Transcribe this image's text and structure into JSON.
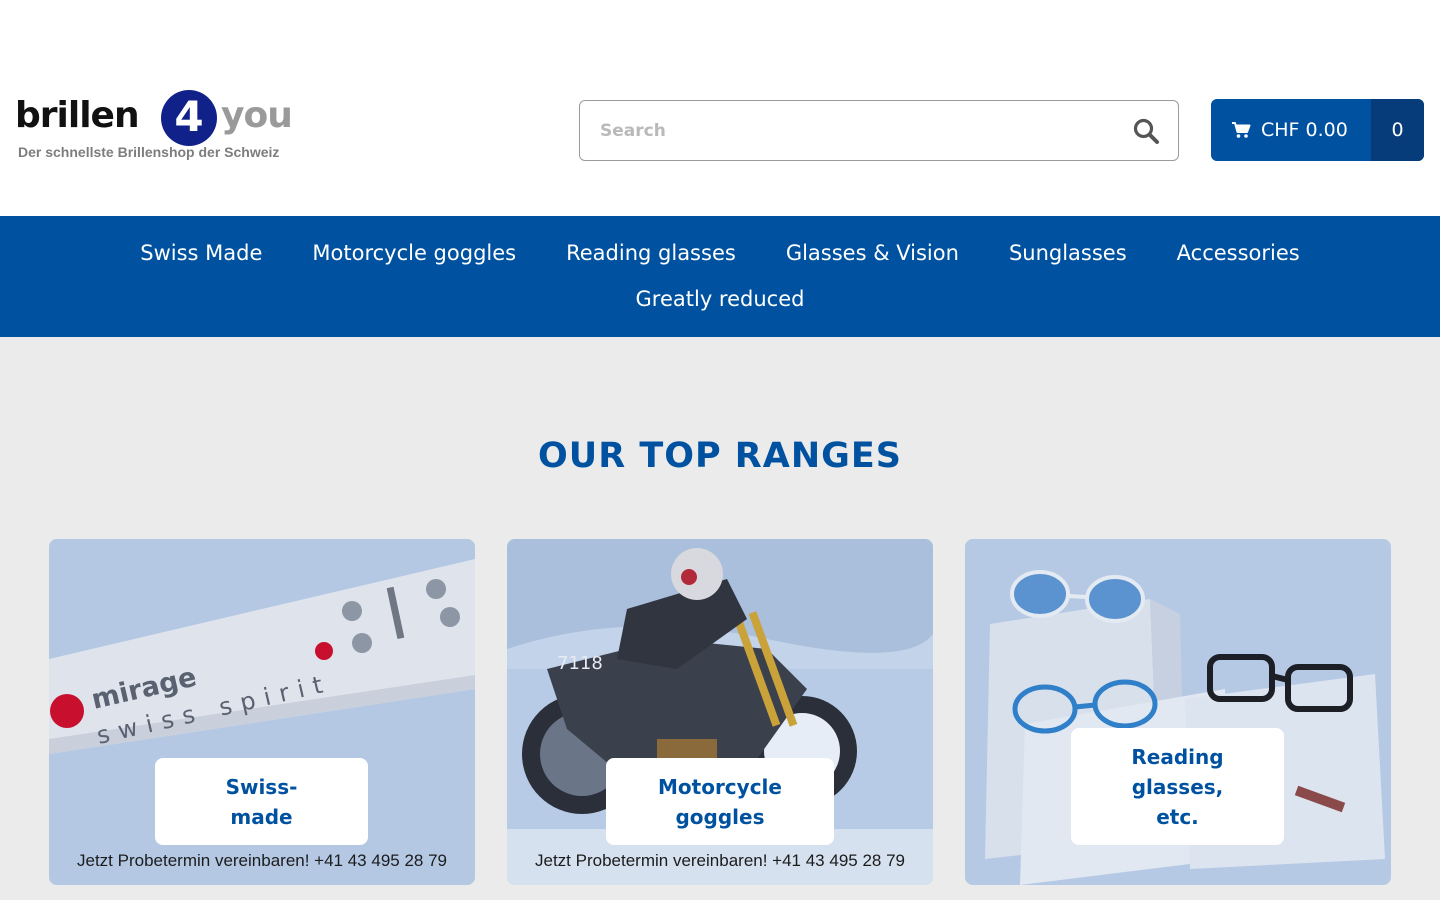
{
  "brand": {
    "name_part1": "brillen",
    "name_digit": "4",
    "name_part2": "you",
    "tagline": "Der schnellste Brillenshop der Schweiz"
  },
  "search": {
    "placeholder": "Search",
    "icon": "magnifier-icon"
  },
  "cart": {
    "icon": "shopping-cart-icon",
    "total": "CHF 0.00",
    "count": "0"
  },
  "nav": {
    "items": [
      {
        "label": "Swiss Made"
      },
      {
        "label": "Motorcycle goggles"
      },
      {
        "label": "Reading glasses"
      },
      {
        "label": "Glasses & Vision"
      },
      {
        "label": "Sunglasses"
      },
      {
        "label": "Accessories"
      },
      {
        "label": "Greatly reduced"
      }
    ]
  },
  "ranges": {
    "title": "OUR TOP RANGES",
    "cards": [
      {
        "label": "Swiss-\nmade",
        "promo": "Jetzt Probetermin vereinbaren! +41 43 495 28 79",
        "image_text_brand": "mirage",
        "image_text_sub": "swiss spirit"
      },
      {
        "label": "Motorcycle\ngoggles",
        "promo": "Jetzt Probetermin vereinbaren! +41 43 495 28 79",
        "image_text_number": "7118"
      },
      {
        "label": "Reading\nglasses,\netc."
      }
    ]
  },
  "colors": {
    "brand_blue": "#0052a0",
    "brand_dark_blue": "#063c7a",
    "page_background": "#ebebec"
  }
}
